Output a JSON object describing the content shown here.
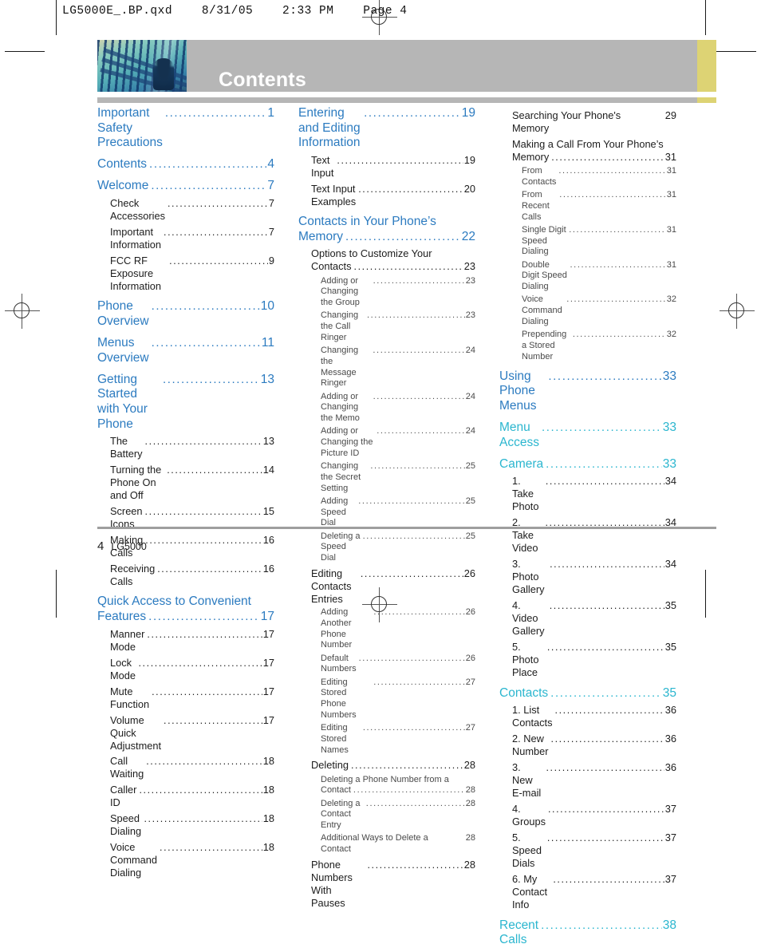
{
  "preflight": {
    "text": "LG5000E_.BP.qxd    8/31/05    2:33 PM    Page 4"
  },
  "banner": {
    "title": "Contents",
    "thumbnail_name": "building-columns-photo",
    "bar_color": "#b6b6b6",
    "accent_color": "#ddd374"
  },
  "colors": {
    "heading_blue": "#2c7bc0",
    "heading_teal": "#2bb6cf",
    "body_black": "#1c1c1c",
    "subentry_gray": "#4a4a4a"
  },
  "footer": {
    "page_number": "4",
    "model": "LG5000"
  },
  "leader": "...........................................................",
  "columns": [
    {
      "id": "column-1",
      "entries": [
        {
          "level": 1,
          "text": "Important Safety Precautions",
          "page": "1"
        },
        {
          "level": 1,
          "text": "Contents",
          "page": "4"
        },
        {
          "level": 1,
          "text": "Welcome",
          "page": "7"
        },
        {
          "level": 2,
          "text": "Check Accessories",
          "page": "7"
        },
        {
          "level": 2,
          "text": "Important Information",
          "page": "7"
        },
        {
          "level": 2,
          "text": "FCC RF Exposure Information",
          "page": "9"
        },
        {
          "level": 1,
          "text": "Phone Overview",
          "page": "10"
        },
        {
          "level": 1,
          "text": "Menus Overview",
          "page": "11"
        },
        {
          "level": 1,
          "text": "Getting Started with Your Phone",
          "page": "13"
        },
        {
          "level": 2,
          "text": "The Battery",
          "page": "13"
        },
        {
          "level": 2,
          "text": "Turning the Phone On and Off",
          "page": "14"
        },
        {
          "level": 2,
          "text": "Screen Icons",
          "page": "15"
        },
        {
          "level": 2,
          "text": "Making Calls",
          "page": "16"
        },
        {
          "level": 2,
          "text": "Receiving Calls",
          "page": "16"
        },
        {
          "level": 1,
          "text": "Quick Access to Convenient Features",
          "page": "17",
          "wrap_first": "Quick Access to Convenient",
          "wrap_second": "Features"
        },
        {
          "level": 2,
          "text": "Manner Mode",
          "page": "17"
        },
        {
          "level": 2,
          "text": "Lock Mode",
          "page": "17"
        },
        {
          "level": 2,
          "text": "Mute Function",
          "page": "17"
        },
        {
          "level": 2,
          "text": "Volume Quick Adjustment",
          "page": "17"
        },
        {
          "level": 2,
          "text": "Call Waiting",
          "page": "18"
        },
        {
          "level": 2,
          "text": "Caller ID",
          "page": "18"
        },
        {
          "level": 2,
          "text": "Speed Dialing",
          "page": "18"
        },
        {
          "level": 2,
          "text": "Voice Command Dialing",
          "page": "18"
        }
      ]
    },
    {
      "id": "column-2",
      "entries": [
        {
          "level": 1,
          "text": "Entering and Editing Information",
          "page": "19"
        },
        {
          "level": 2,
          "text": "Text Input",
          "page": "19"
        },
        {
          "level": 2,
          "text": "Text Input Examples",
          "page": "20"
        },
        {
          "level": 1,
          "text": "Contacts in Your Phone's Memory",
          "page": "22",
          "wrap_first": "Contacts in Your Phone’s",
          "wrap_second": "Memory"
        },
        {
          "level": 2,
          "text": "Options to Customize Your Contacts",
          "page": "23",
          "wrap_first": "Options to Customize Your",
          "wrap_second": "Contacts"
        },
        {
          "level": 3,
          "text": "Adding or Changing the Group",
          "page": "23"
        },
        {
          "level": 3,
          "text": "Changing the Call Ringer",
          "page": "23"
        },
        {
          "level": 3,
          "text": "Changing the Message Ringer",
          "page": "24"
        },
        {
          "level": 3,
          "text": "Adding or Changing the Memo",
          "page": "24"
        },
        {
          "level": 3,
          "text": "Adding or Changing the Picture ID",
          "page": "24"
        },
        {
          "level": 3,
          "text": "Changing the Secret Setting",
          "page": "25"
        },
        {
          "level": 3,
          "text": "Adding Speed Dial",
          "page": "25"
        },
        {
          "level": 3,
          "text": "Deleting a Speed Dial",
          "page": "25"
        },
        {
          "level": 2,
          "text": "Editing Contacts Entries",
          "page": "26"
        },
        {
          "level": 3,
          "text": "Adding Another Phone Number",
          "page": "26"
        },
        {
          "level": 3,
          "text": "Default Numbers",
          "page": "26"
        },
        {
          "level": 3,
          "text": "Editing Stored Phone Numbers",
          "page": "27"
        },
        {
          "level": 3,
          "text": "Editing Stored Names",
          "page": "27"
        },
        {
          "level": 2,
          "text": "Deleting",
          "page": "28"
        },
        {
          "level": 3,
          "text": "Deleting a Phone Number from a Contact",
          "page": "28",
          "wrap_first": "Deleting a Phone Number from a",
          "wrap_second": "Contact"
        },
        {
          "level": 3,
          "text": "Deleting a Contact Entry",
          "page": "28"
        },
        {
          "level": 3,
          "text": "Additional Ways to Delete a Contact",
          "page": "28",
          "no_dots": true
        },
        {
          "level": 2,
          "text": "Phone Numbers With Pauses",
          "page": "28"
        }
      ]
    },
    {
      "id": "column-3",
      "entries": [
        {
          "level": 2,
          "text": "Searching Your Phone's Memory",
          "page": "29",
          "no_dots": true
        },
        {
          "level": 2,
          "text": "Making a Call From Your Phone's Memory",
          "page": "31",
          "wrap_first": "Making a Call From Your Phone’s",
          "wrap_second": "Memory"
        },
        {
          "level": 3,
          "text": "From Contacts",
          "page": "31"
        },
        {
          "level": 3,
          "text": "From Recent Calls",
          "page": "31"
        },
        {
          "level": 3,
          "text": "Single Digit Speed Dialing",
          "page": "31"
        },
        {
          "level": 3,
          "text": "Double Digit Speed Dialing",
          "page": "31"
        },
        {
          "level": 3,
          "text": "Voice Command Dialing",
          "page": "32"
        },
        {
          "level": 3,
          "text": "Prepending a Stored Number",
          "page": "32"
        },
        {
          "level": 1,
          "text": "Using Phone Menus",
          "page": "33"
        },
        {
          "level": 1,
          "text": "Menu Access",
          "page": "33",
          "teal": true
        },
        {
          "level": 1,
          "text": "Camera",
          "page": "33",
          "teal": true
        },
        {
          "level": 2,
          "text": "1. Take Photo",
          "page": "34"
        },
        {
          "level": 2,
          "text": "2. Take Video",
          "page": "34"
        },
        {
          "level": 2,
          "text": "3. Photo Gallery",
          "page": "34"
        },
        {
          "level": 2,
          "text": "4. Video Gallery",
          "page": "35"
        },
        {
          "level": 2,
          "text": "5. Photo Place",
          "page": "35"
        },
        {
          "level": 1,
          "text": "Contacts",
          "page": "35",
          "teal": true
        },
        {
          "level": 2,
          "text": "1. List Contacts",
          "page": "36"
        },
        {
          "level": 2,
          "text": "2. New Number",
          "page": "36"
        },
        {
          "level": 2,
          "text": "3. New E-mail",
          "page": "36"
        },
        {
          "level": 2,
          "text": "4. Groups",
          "page": "37"
        },
        {
          "level": 2,
          "text": "5. Speed Dials",
          "page": "37"
        },
        {
          "level": 2,
          "text": "6. My Contact Info",
          "page": "37"
        },
        {
          "level": 1,
          "text": "Recent Calls",
          "page": "38",
          "teal": true
        }
      ]
    }
  ]
}
